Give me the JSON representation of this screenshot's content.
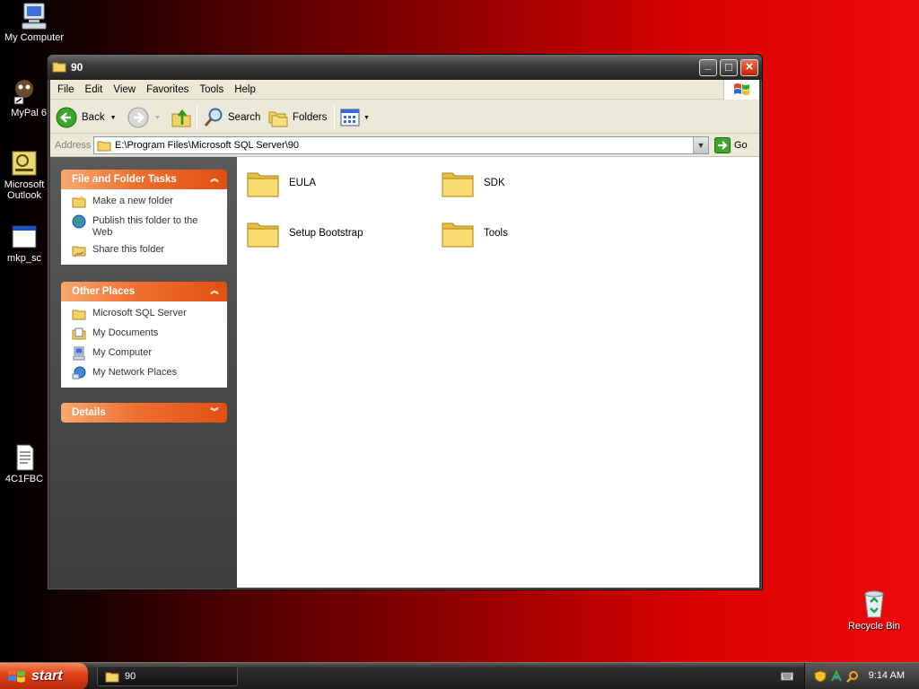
{
  "desktop": {
    "icons": [
      {
        "label": "My Computer"
      },
      {
        "label": "MyPal 6"
      },
      {
        "label": "Microsoft Outlook"
      },
      {
        "label": "mkp_sc"
      },
      {
        "label": "4C1FBC"
      },
      {
        "label": "Recycle Bin"
      }
    ]
  },
  "window": {
    "title": "90",
    "controls": {
      "minimize": "_",
      "maximize": "□",
      "close": "×"
    },
    "menu": [
      "File",
      "Edit",
      "View",
      "Favorites",
      "Tools",
      "Help"
    ],
    "toolbar": {
      "back_label": "Back",
      "search_label": "Search",
      "folders_label": "Folders"
    },
    "address": {
      "label": "Address",
      "path": "E:\\Program Files\\Microsoft SQL Server\\90",
      "go_label": "Go"
    },
    "sidebar": {
      "file_tasks": {
        "title": "File and Folder Tasks",
        "items": [
          {
            "label": "Make a new folder",
            "icon": "new-folder-icon"
          },
          {
            "label": "Publish this folder to the Web",
            "icon": "globe-icon"
          },
          {
            "label": "Share this folder",
            "icon": "share-folder-icon"
          }
        ]
      },
      "other_places": {
        "title": "Other Places",
        "items": [
          {
            "label": "Microsoft SQL Server",
            "icon": "folder-icon"
          },
          {
            "label": "My Documents",
            "icon": "documents-icon"
          },
          {
            "label": "My Computer",
            "icon": "computer-icon"
          },
          {
            "label": "My Network Places",
            "icon": "network-icon"
          }
        ]
      },
      "details": {
        "title": "Details"
      }
    },
    "folders": [
      {
        "label": "EULA"
      },
      {
        "label": "SDK"
      },
      {
        "label": "Setup Bootstrap"
      },
      {
        "label": "Tools"
      }
    ]
  },
  "taskbar": {
    "start_label": "start",
    "tasks": [
      {
        "label": "90"
      }
    ],
    "clock": "9:14 AM"
  },
  "colors": {
    "desktop_dark": "#000000",
    "desktop_red": "#ee0a0a",
    "task_header_orange": "#f07030",
    "start_orange": "#e0401a"
  }
}
